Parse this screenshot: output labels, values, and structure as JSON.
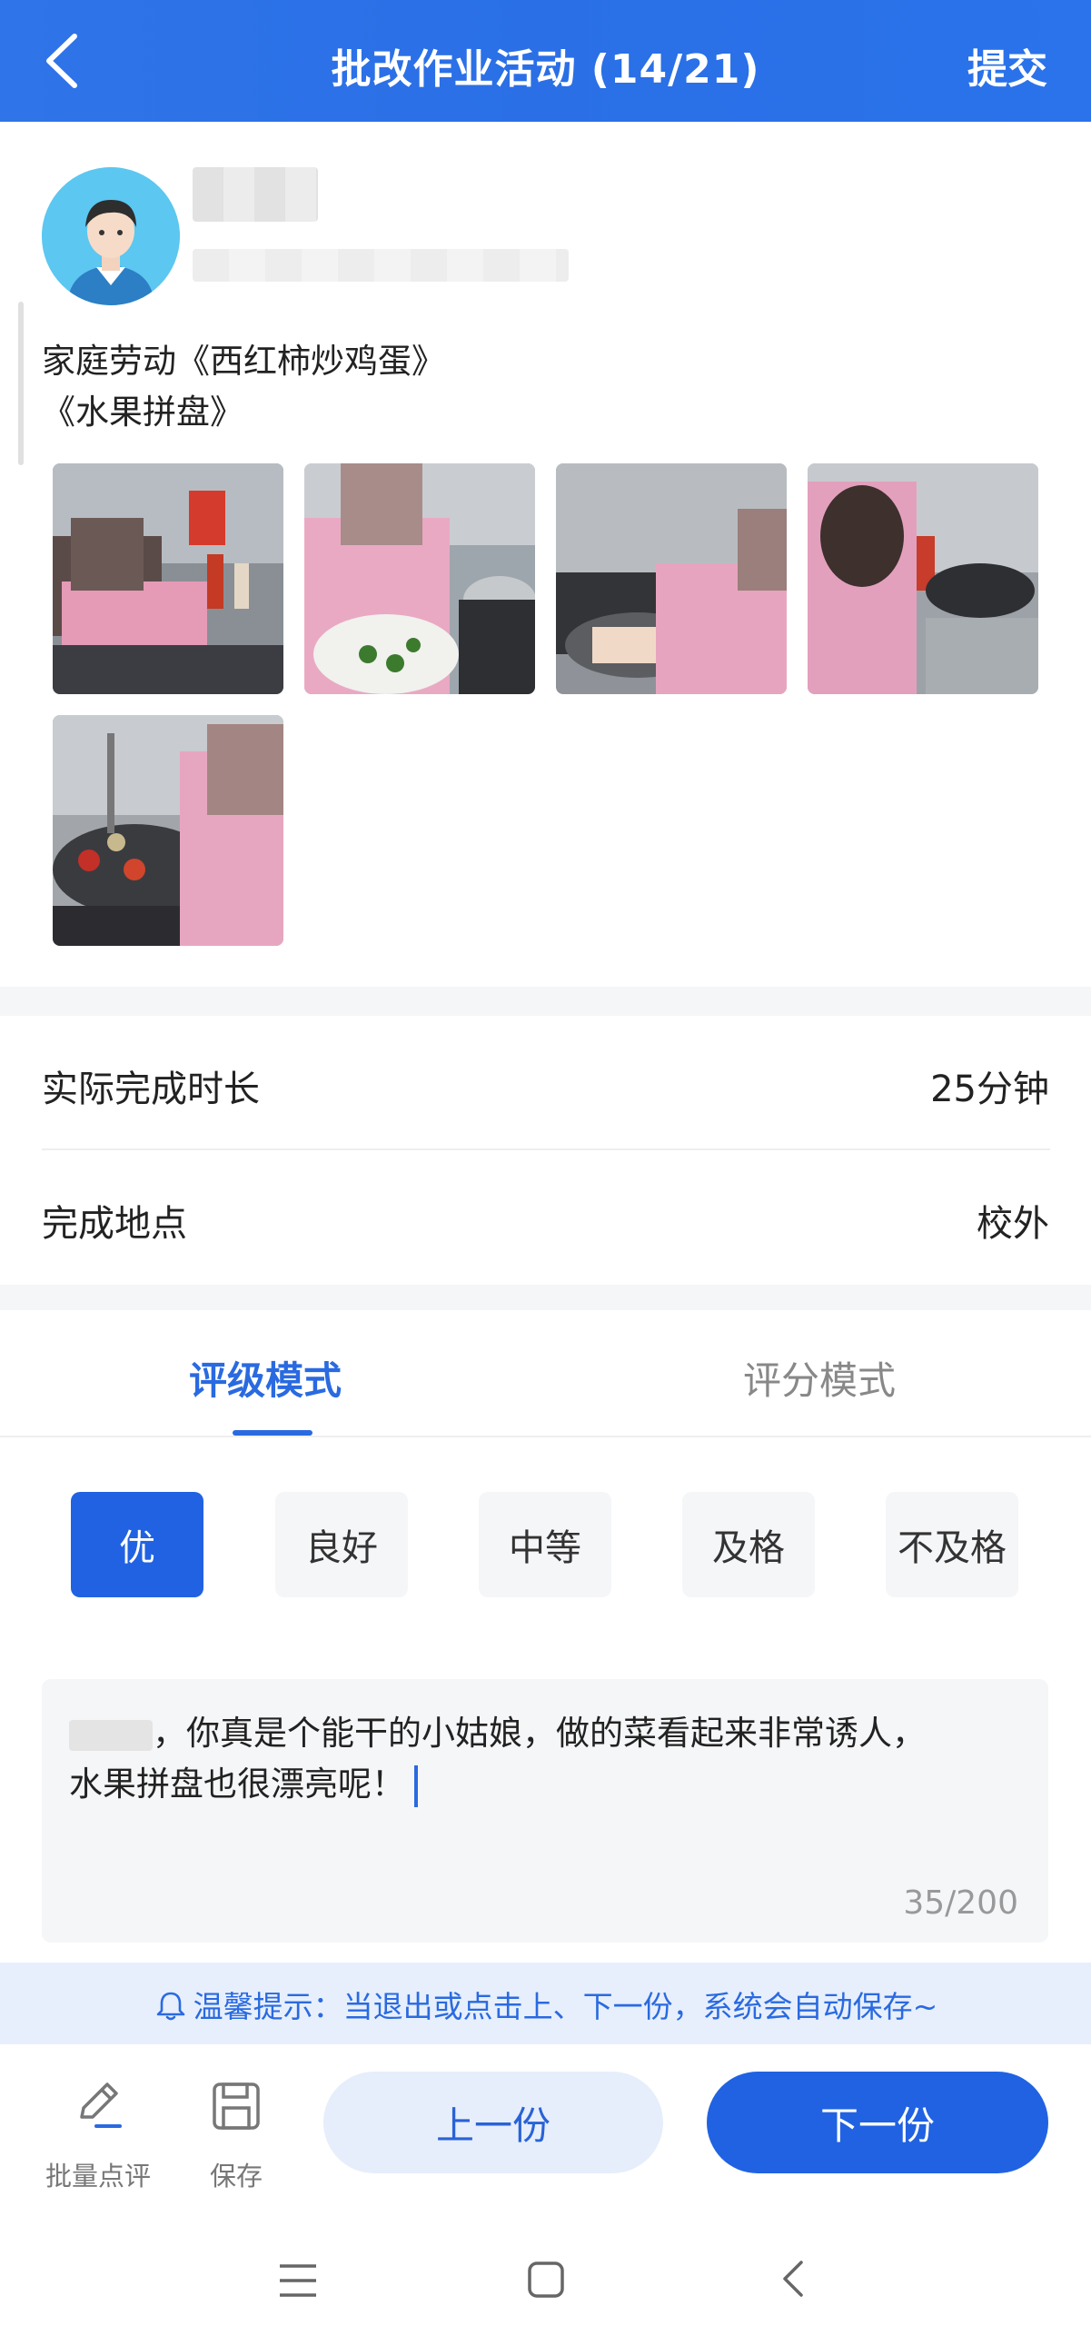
{
  "header": {
    "title": "批改作业活动 (14/21)",
    "submit_label": "提交",
    "back_icon": "chevron-left-icon"
  },
  "student": {
    "avatar_icon": "user-avatar-icon",
    "homework_lines": [
      "家庭劳动《西红柿炒鸡蛋》",
      "《水果拼盘》"
    ],
    "photo_count": 5
  },
  "info": {
    "duration_label": "实际完成时长",
    "duration_value": "25分钟",
    "location_label": "完成地点",
    "location_value": "校外"
  },
  "grading": {
    "tabs": [
      {
        "label": "评级模式",
        "active": true
      },
      {
        "label": "评分模式",
        "active": false
      }
    ],
    "grades": [
      {
        "label": "优",
        "selected": true
      },
      {
        "label": "良好",
        "selected": false
      },
      {
        "label": "中等",
        "selected": false
      },
      {
        "label": "及格",
        "selected": false
      },
      {
        "label": "不及格",
        "selected": false
      }
    ],
    "comment_line1": "，你真是个能干的小姑娘，做的菜看起来非常诱人，",
    "comment_line2": "水果拼盘也很漂亮呢！",
    "char_count": "35/200"
  },
  "tip": {
    "icon": "bell-icon",
    "text": "温馨提示：当退出或点击上、下一份，系统会自动保存~"
  },
  "toolbar": {
    "batch_label": "批量点评",
    "batch_icon": "pencil-icon",
    "save_label": "保存",
    "save_icon": "floppy-disk-icon",
    "prev_label": "上一份",
    "next_label": "下一份"
  },
  "colors": {
    "accent": "#2062e2",
    "header": "#2f74e8",
    "tip_bg": "#e7effc"
  }
}
